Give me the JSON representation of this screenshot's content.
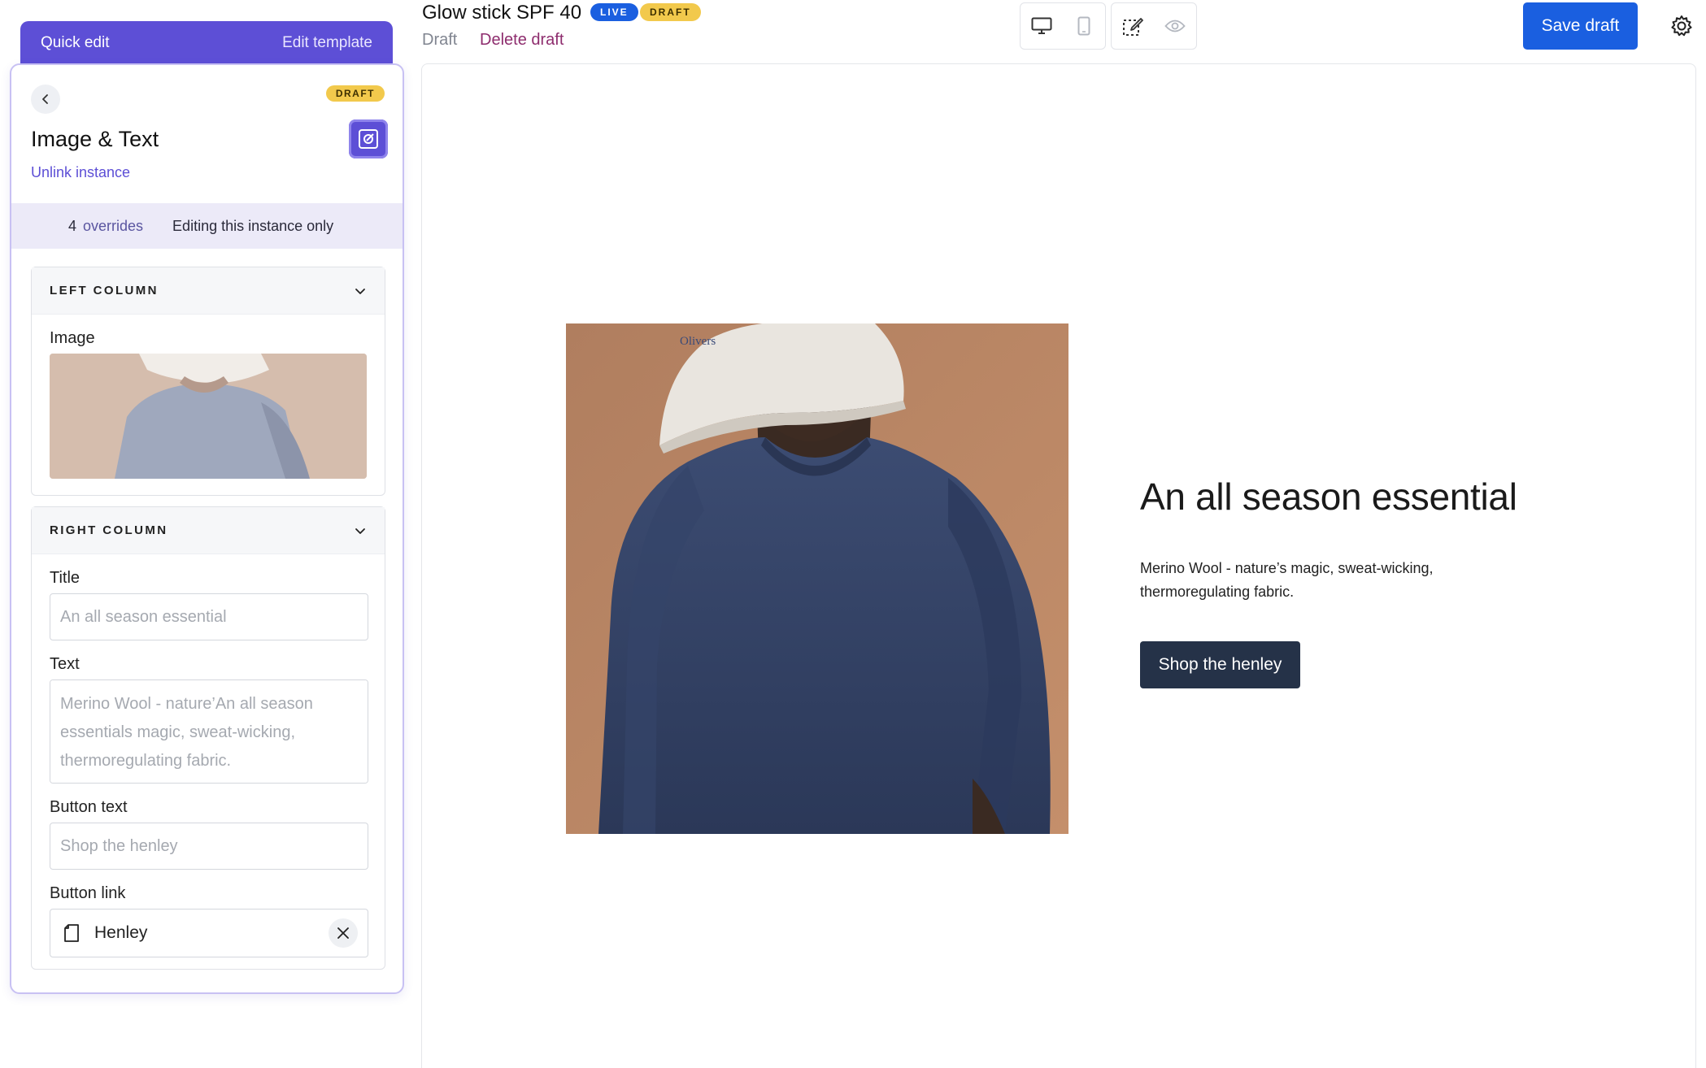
{
  "quick_edit": {
    "label": "Quick edit",
    "edit_template": "Edit template"
  },
  "panel": {
    "badge": "DRAFT",
    "title": "Image & Text",
    "unlink": "Unlink instance",
    "override_count": "4",
    "override_label": "overrides",
    "edit_mode": "Editing this instance only",
    "left_column": {
      "heading": "LEFT COLUMN",
      "image_label": "Image"
    },
    "right_column": {
      "heading": "RIGHT COLUMN",
      "title_label": "Title",
      "title_placeholder": "An all season essential",
      "text_label": "Text",
      "text_placeholder": "Merino Wool - nature’An all season essentials magic, sweat-wicking, thermoregulating fabric.",
      "button_text_label": "Button text",
      "button_text_placeholder": "Shop the henley",
      "button_link_label": "Button link",
      "button_link_value": "Henley"
    }
  },
  "header": {
    "title": "Glow stick SPF 40",
    "badge_live": "LIVE",
    "badge_draft": "DRAFT",
    "status": "Draft",
    "delete": "Delete draft",
    "save": "Save draft"
  },
  "preview": {
    "cap_text": "Olivers",
    "title": "An all season essential",
    "text": "Merino Wool - nature’s magic, sweat-wicking, thermoregulating fabric.",
    "button": "Shop the henley"
  },
  "colors": {
    "accent": "#5d4fd6",
    "primary_blue": "#1a5fe0",
    "draft_yellow": "#f2c94c",
    "delete_red": "#8e2d6e",
    "dark_button": "#253248"
  },
  "icons": [
    "chevron-left-icon",
    "link-instance-icon",
    "chevron-down-icon",
    "document-icon",
    "close-icon",
    "desktop-icon",
    "mobile-icon",
    "edit-select-icon",
    "eye-icon",
    "gear-icon"
  ]
}
